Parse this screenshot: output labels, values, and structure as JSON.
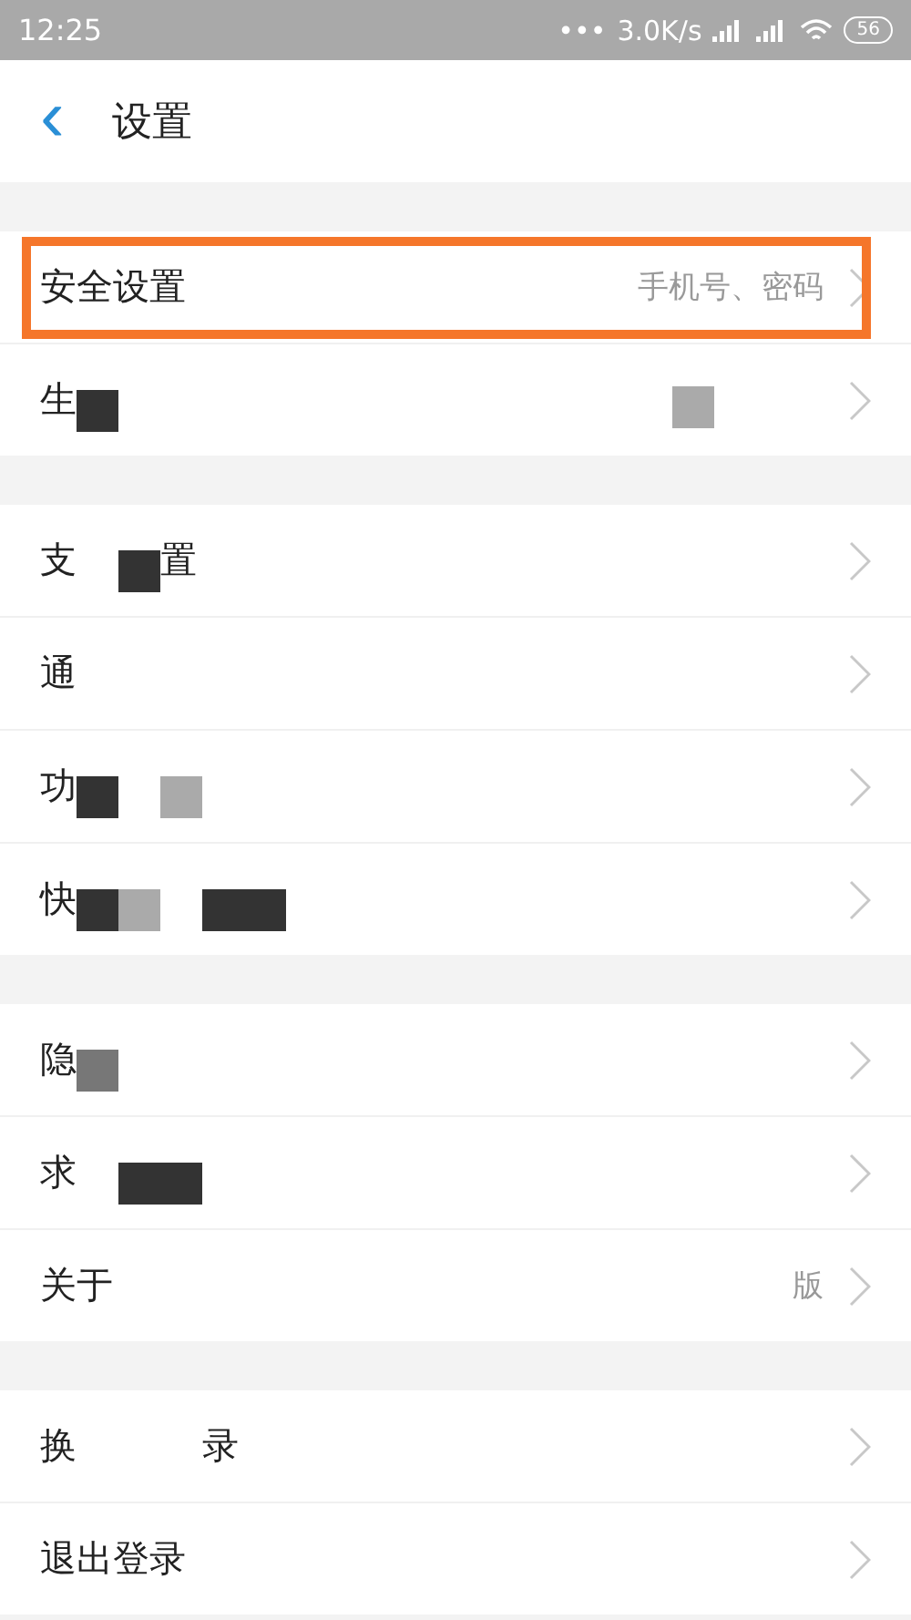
{
  "status_bar": {
    "time": "12:25",
    "dots": "•••",
    "speed": "3.0K/s",
    "battery": "56"
  },
  "header": {
    "back": "‹",
    "title": "设置"
  },
  "groups": [
    {
      "rows": [
        {
          "segments": [
            {
              "kind": "text",
              "text": "安全设置"
            }
          ],
          "value": "手机号、密码",
          "highlighted": true
        },
        {
          "segments": [
            {
              "kind": "text",
              "text": "生"
            },
            {
              "kind": "redaction-dark"
            }
          ],
          "value_redacted": true,
          "highlighted": false
        }
      ]
    },
    {
      "rows": [
        {
          "segments": [
            {
              "kind": "text",
              "text": "支"
            },
            {
              "kind": "gap"
            },
            {
              "kind": "redaction-dark"
            },
            {
              "kind": "text",
              "text": "置"
            }
          ],
          "highlighted": false
        },
        {
          "segments": [
            {
              "kind": "text",
              "text": "通"
            }
          ],
          "highlighted": false
        },
        {
          "segments": [
            {
              "kind": "text",
              "text": "功"
            },
            {
              "kind": "redaction-dark"
            },
            {
              "kind": "gap"
            },
            {
              "kind": "redaction-light"
            }
          ],
          "highlighted": false
        },
        {
          "segments": [
            {
              "kind": "text",
              "text": "快"
            },
            {
              "kind": "redaction-dark"
            },
            {
              "kind": "redaction-light"
            },
            {
              "kind": "gap"
            },
            {
              "kind": "redaction-dark"
            },
            {
              "kind": "redaction-dark"
            }
          ],
          "highlighted": false
        }
      ]
    },
    {
      "rows": [
        {
          "segments": [
            {
              "kind": "text",
              "text": "隐"
            },
            {
              "kind": "redaction-mid"
            }
          ],
          "highlighted": false
        },
        {
          "segments": [
            {
              "kind": "text",
              "text": "求"
            },
            {
              "kind": "gap"
            },
            {
              "kind": "redaction-dark"
            },
            {
              "kind": "redaction-dark"
            }
          ],
          "highlighted": false
        },
        {
          "segments": [
            {
              "kind": "text",
              "text": "关于"
            }
          ],
          "value": "版",
          "highlighted": false
        }
      ]
    },
    {
      "rows": [
        {
          "segments": [
            {
              "kind": "text",
              "text": "换"
            },
            {
              "kind": "gap"
            },
            {
              "kind": "gap"
            },
            {
              "kind": "gap"
            },
            {
              "kind": "text",
              "text": "录"
            }
          ],
          "highlighted": false
        },
        {
          "segments": [
            {
              "kind": "text",
              "text": "退出登录"
            }
          ],
          "highlighted": false
        }
      ]
    }
  ]
}
